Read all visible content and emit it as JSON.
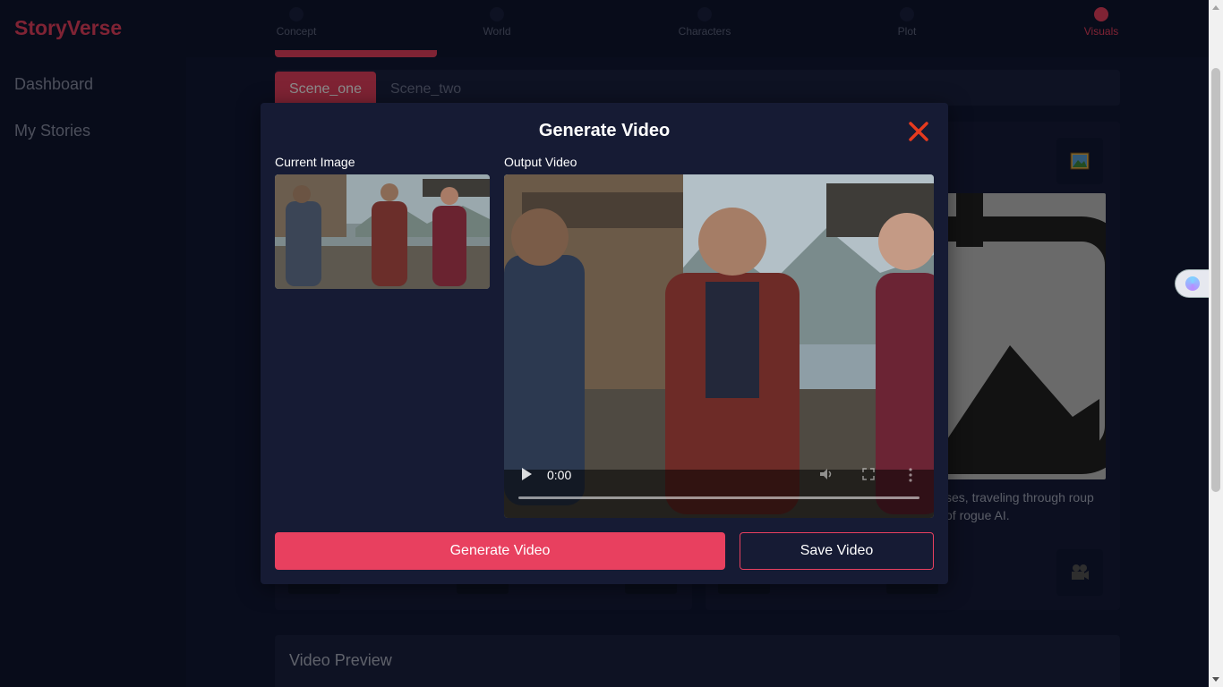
{
  "sidebar": {
    "brand": "StoryVerse",
    "items": [
      {
        "label": "Dashboard"
      },
      {
        "label": "My Stories"
      }
    ]
  },
  "stepper": {
    "steps": [
      {
        "label": "Concept",
        "active": false
      },
      {
        "label": "World",
        "active": false
      },
      {
        "label": "Characters",
        "active": false
      },
      {
        "label": "Plot",
        "active": false
      },
      {
        "label": "Visuals",
        "active": true
      }
    ]
  },
  "scenes": {
    "tabs": [
      {
        "label": "Scene_one",
        "active": true
      },
      {
        "label": "Scene_two",
        "active": false
      }
    ]
  },
  "scene_card": {
    "description_fragment": "ses, traveling through roup of rogue AI.",
    "image_icon": "image-icon",
    "video_icon": "camera-icon"
  },
  "video_preview": {
    "title": "Video Preview"
  },
  "modal": {
    "title": "Generate Video",
    "current_image_label": "Current Image",
    "output_video_label": "Output Video",
    "video_time": "0:00",
    "generate_button": "Generate Video",
    "save_button": "Save Video"
  },
  "colors": {
    "accent": "#e8405f",
    "background": "#121936",
    "sidebar": "#0f1630",
    "modal": "#161b34"
  }
}
